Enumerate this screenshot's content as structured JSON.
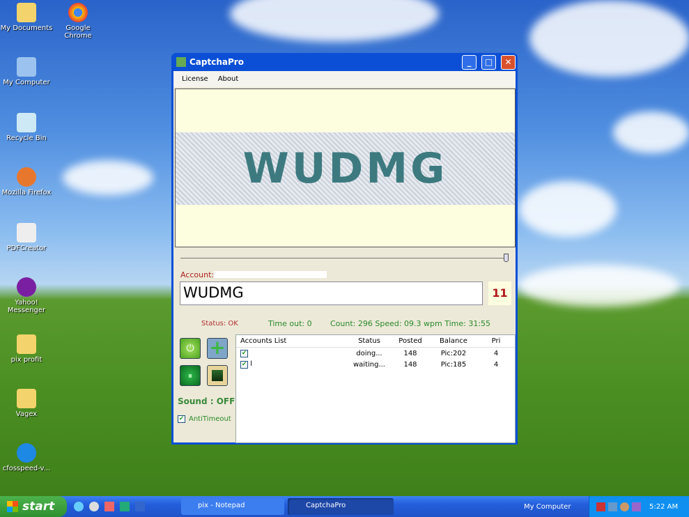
{
  "desktop": {
    "icons": [
      "My Documents",
      "Google Chrome",
      "My Computer",
      "Recycle Bin",
      "Mozilla Firefox",
      "PDFCreator",
      "Yahoo! Messenger",
      "pix profit",
      "Vagex",
      "cfosspeed-v..."
    ]
  },
  "window": {
    "title": "CaptchaPro",
    "menu": [
      "License",
      "About"
    ],
    "captcha_text": "WUDMG",
    "account_label": "Account:",
    "input_value": "WUDMG",
    "countdown": "11",
    "status": "Status: OK",
    "timeout": "Time out: 0",
    "stats": "Count: 296 Speed: 09.3 wpm Time: 31:55",
    "sound": "Sound : OFF",
    "antitimeout": "AntiTimeout",
    "list": {
      "headers": [
        "Accounts List",
        "Status",
        "Posted",
        "Balance",
        "Pri"
      ],
      "rows": [
        {
          "name": "",
          "status": "doing...",
          "posted": "148",
          "balance": "Pic:202",
          "pri": "4"
        },
        {
          "name": "l",
          "status": "waiting...",
          "posted": "148",
          "balance": "Pic:185",
          "pri": "4"
        }
      ]
    }
  },
  "taskbar": {
    "start": "start",
    "tasks": [
      "pix - Notepad",
      "CaptchaPro"
    ],
    "toolbar": "My Computer",
    "clock": "5:22 AM"
  }
}
